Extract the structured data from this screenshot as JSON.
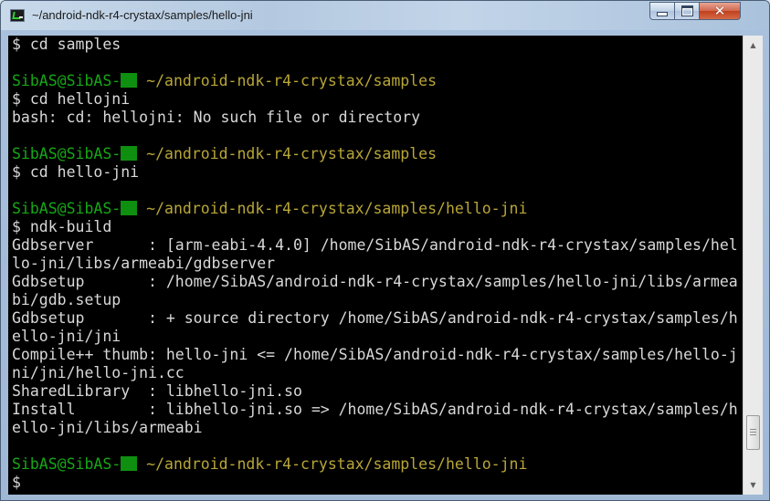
{
  "window": {
    "title": "~/android-ndk-r4-crystax/samples/hello-jni",
    "icon": "terminal-icon"
  },
  "caption_buttons": {
    "minimize_icon": "minimize-icon",
    "maximize_icon": "maximize-icon",
    "close_icon": "close-icon",
    "close_glyph": "✕"
  },
  "terminal": {
    "user_host": "SibAS@SibAS-",
    "colors": {
      "background": "#000000",
      "text": "#d8d8d8",
      "user": "#15a815",
      "path": "#b8a638"
    },
    "lines": [
      {
        "type": "output",
        "text": "$ cd samples"
      },
      {
        "type": "blank",
        "text": ""
      },
      {
        "type": "prompt",
        "path": " ~/android-ndk-r4-crystax/samples"
      },
      {
        "type": "output",
        "text": "$ cd hellojni"
      },
      {
        "type": "output",
        "text": "bash: cd: hellojni: No such file or directory"
      },
      {
        "type": "blank",
        "text": ""
      },
      {
        "type": "prompt",
        "path": " ~/android-ndk-r4-crystax/samples"
      },
      {
        "type": "output",
        "text": "$ cd hello-jni"
      },
      {
        "type": "blank",
        "text": ""
      },
      {
        "type": "prompt",
        "path": " ~/android-ndk-r4-crystax/samples/hello-jni"
      },
      {
        "type": "output",
        "text": "$ ndk-build"
      },
      {
        "type": "output",
        "text": "Gdbserver      : [arm-eabi-4.4.0] /home/SibAS/android-ndk-r4-crystax/samples/hel"
      },
      {
        "type": "output",
        "text": "lo-jni/libs/armeabi/gdbserver"
      },
      {
        "type": "output",
        "text": "Gdbsetup       : /home/SibAS/android-ndk-r4-crystax/samples/hello-jni/libs/armea"
      },
      {
        "type": "output",
        "text": "bi/gdb.setup"
      },
      {
        "type": "output",
        "text": "Gdbsetup       : + source directory /home/SibAS/android-ndk-r4-crystax/samples/h"
      },
      {
        "type": "output",
        "text": "ello-jni/jni"
      },
      {
        "type": "output",
        "text": "Compile++ thumb: hello-jni <= /home/SibAS/android-ndk-r4-crystax/samples/hello-j"
      },
      {
        "type": "output",
        "text": "ni/jni/hello-jni.cc"
      },
      {
        "type": "output",
        "text": "SharedLibrary  : libhello-jni.so"
      },
      {
        "type": "output",
        "text": "Install        : libhello-jni.so => /home/SibAS/android-ndk-r4-crystax/samples/h"
      },
      {
        "type": "output",
        "text": "ello-jni/libs/armeabi"
      },
      {
        "type": "blank",
        "text": ""
      },
      {
        "type": "prompt",
        "path": " ~/android-ndk-r4-crystax/samples/hello-jni"
      },
      {
        "type": "output",
        "text": "$"
      }
    ]
  },
  "scrollbar": {
    "up_glyph": "▲",
    "down_glyph": "▼",
    "position_fraction": 0.93
  }
}
